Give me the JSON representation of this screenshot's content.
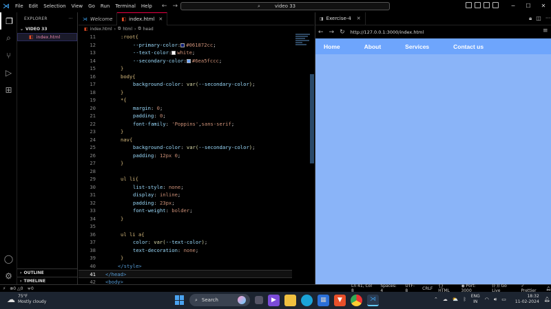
{
  "window": {
    "menu": [
      "File",
      "Edit",
      "Selection",
      "View",
      "Go",
      "Run",
      "Terminal",
      "Help"
    ],
    "search_text": "video 33"
  },
  "sidebar": {
    "title": "EXPLORER",
    "folder": "VIDEO 33",
    "file": "index.html",
    "outline": "OUTLINE",
    "timeline": "TIMELINE"
  },
  "editor": {
    "tabs": [
      {
        "label": "Welcome",
        "active": false
      },
      {
        "label": "index.html",
        "active": true
      }
    ],
    "breadcrumb": [
      "index.html",
      "html",
      "head"
    ],
    "lines": [
      {
        "n": "11",
        "indent": 1,
        "tokens": [
          [
            "sel",
            ":root{"
          ]
        ]
      },
      {
        "n": "12",
        "indent": 2,
        "tokens": [
          [
            "prop",
            "--primary-color"
          ],
          [
            "pun",
            ":"
          ],
          [
            "sw",
            "#061872"
          ],
          [
            "val",
            "#061872cc"
          ],
          [
            "pun",
            ";"
          ]
        ]
      },
      {
        "n": "13",
        "indent": 2,
        "tokens": [
          [
            "prop",
            "--text-color"
          ],
          [
            "pun",
            ":"
          ],
          [
            "sw",
            "#ffffff"
          ],
          [
            "val",
            "white"
          ],
          [
            "pun",
            ";"
          ]
        ]
      },
      {
        "n": "14",
        "indent": 2,
        "tokens": [
          [
            "prop",
            "--secondary-color"
          ],
          [
            "pun",
            ":"
          ],
          [
            "sw",
            "#6ea5fc"
          ],
          [
            "val",
            "#6ea5fccc"
          ],
          [
            "pun",
            ";"
          ]
        ]
      },
      {
        "n": "15",
        "indent": 1,
        "tokens": [
          [
            "sel",
            "}"
          ]
        ]
      },
      {
        "n": "16",
        "indent": 1,
        "tokens": [
          [
            "sel",
            "body{"
          ]
        ]
      },
      {
        "n": "17",
        "indent": 2,
        "tokens": [
          [
            "prop",
            "background-color"
          ],
          [
            "pun",
            ": "
          ],
          [
            "fn",
            "var("
          ],
          [
            "var",
            "--secondary-color"
          ],
          [
            "fn",
            ")"
          ],
          [
            "pun",
            ";"
          ]
        ]
      },
      {
        "n": "18",
        "indent": 1,
        "tokens": [
          [
            "sel",
            "}"
          ]
        ]
      },
      {
        "n": "19",
        "indent": 1,
        "tokens": [
          [
            "sel",
            "*{"
          ]
        ]
      },
      {
        "n": "20",
        "indent": 2,
        "tokens": [
          [
            "prop",
            "margin"
          ],
          [
            "pun",
            ": "
          ],
          [
            "val",
            "0"
          ],
          [
            "pun",
            ";"
          ]
        ]
      },
      {
        "n": "21",
        "indent": 2,
        "tokens": [
          [
            "prop",
            "padding"
          ],
          [
            "pun",
            ": "
          ],
          [
            "val",
            "0"
          ],
          [
            "pun",
            ";"
          ]
        ]
      },
      {
        "n": "22",
        "indent": 2,
        "tokens": [
          [
            "prop",
            "font-family"
          ],
          [
            "pun",
            ": "
          ],
          [
            "val",
            "'Poppins'"
          ],
          [
            "pun",
            ","
          ],
          [
            "val",
            "sans-serif"
          ],
          [
            "pun",
            ";"
          ]
        ]
      },
      {
        "n": "23",
        "indent": 1,
        "tokens": [
          [
            "sel",
            "}"
          ]
        ]
      },
      {
        "n": "24",
        "indent": 1,
        "tokens": [
          [
            "sel",
            "nav{"
          ]
        ]
      },
      {
        "n": "25",
        "indent": 2,
        "tokens": [
          [
            "prop",
            "background-color"
          ],
          [
            "pun",
            ": "
          ],
          [
            "fn",
            "var("
          ],
          [
            "var",
            "--secondary-color"
          ],
          [
            "fn",
            ")"
          ],
          [
            "pun",
            ";"
          ]
        ]
      },
      {
        "n": "26",
        "indent": 2,
        "tokens": [
          [
            "prop",
            "padding"
          ],
          [
            "pun",
            ": "
          ],
          [
            "val",
            "12px 0"
          ],
          [
            "pun",
            ";"
          ]
        ]
      },
      {
        "n": "27",
        "indent": 1,
        "tokens": [
          [
            "sel",
            "}"
          ]
        ]
      },
      {
        "n": "28",
        "indent": 0,
        "tokens": []
      },
      {
        "n": "29",
        "indent": 1,
        "tokens": [
          [
            "sel",
            "ul li{"
          ]
        ]
      },
      {
        "n": "30",
        "indent": 2,
        "tokens": [
          [
            "prop",
            "list-style"
          ],
          [
            "pun",
            ": "
          ],
          [
            "val",
            "none"
          ],
          [
            "pun",
            ";"
          ]
        ]
      },
      {
        "n": "31",
        "indent": 2,
        "tokens": [
          [
            "prop",
            "display"
          ],
          [
            "pun",
            ": "
          ],
          [
            "val",
            "inline"
          ],
          [
            "pun",
            ";"
          ]
        ]
      },
      {
        "n": "32",
        "indent": 2,
        "tokens": [
          [
            "prop",
            "padding"
          ],
          [
            "pun",
            ": "
          ],
          [
            "val",
            "23px"
          ],
          [
            "pun",
            ";"
          ]
        ]
      },
      {
        "n": "33",
        "indent": 2,
        "tokens": [
          [
            "prop",
            "font-weight"
          ],
          [
            "pun",
            ": "
          ],
          [
            "val",
            "bolder"
          ],
          [
            "pun",
            ";"
          ]
        ]
      },
      {
        "n": "34",
        "indent": 1,
        "tokens": [
          [
            "sel",
            "}"
          ]
        ]
      },
      {
        "n": "35",
        "indent": 0,
        "tokens": []
      },
      {
        "n": "36",
        "indent": 1,
        "tokens": [
          [
            "sel",
            "ul li a{"
          ]
        ]
      },
      {
        "n": "37",
        "indent": 2,
        "tokens": [
          [
            "prop",
            "color"
          ],
          [
            "pun",
            ": "
          ],
          [
            "fn",
            "var("
          ],
          [
            "var",
            "--text-color"
          ],
          [
            "fn",
            ")"
          ],
          [
            "pun",
            ";"
          ]
        ]
      },
      {
        "n": "38",
        "indent": 2,
        "tokens": [
          [
            "prop",
            "text-decoration"
          ],
          [
            "pun",
            ": "
          ],
          [
            "val",
            "none"
          ],
          [
            "pun",
            ";"
          ]
        ]
      },
      {
        "n": "39",
        "indent": 1,
        "tokens": [
          [
            "sel",
            "}"
          ]
        ]
      },
      {
        "n": "40",
        "indent": 0,
        "tokens": [
          [
            "tag",
            "</style>"
          ]
        ],
        "pre": "    "
      },
      {
        "n": "41",
        "indent": 0,
        "tokens": [
          [
            "tag",
            "</head>"
          ]
        ],
        "current": true
      },
      {
        "n": "42",
        "indent": 0,
        "tokens": [
          [
            "tag",
            "<body>"
          ]
        ]
      }
    ]
  },
  "browser": {
    "tab_title": "Exercise-4",
    "url": "http://127.0.0.1:3000/index.html",
    "nav_links": [
      "Home",
      "About",
      "Services",
      "Contact us"
    ],
    "page_bg": "#8ab4f8",
    "nav_bg": "#6ea5fc"
  },
  "statusbar": {
    "errors": "0",
    "warnings": "0",
    "info": "0",
    "position": "Ln 41, Col 8",
    "spaces": "Spaces: 4",
    "encoding": "UTF-8",
    "eol": "CRLF",
    "language": "HTML",
    "port": "Port: 3000",
    "golive": "Go Live",
    "prettier": "Prettier"
  },
  "taskbar": {
    "temp": "75°F",
    "weather": "Mostly cloudy",
    "search": "Search",
    "lang1": "ENG",
    "lang2": "IN",
    "time": "18:32",
    "date": "11-02-2024"
  }
}
